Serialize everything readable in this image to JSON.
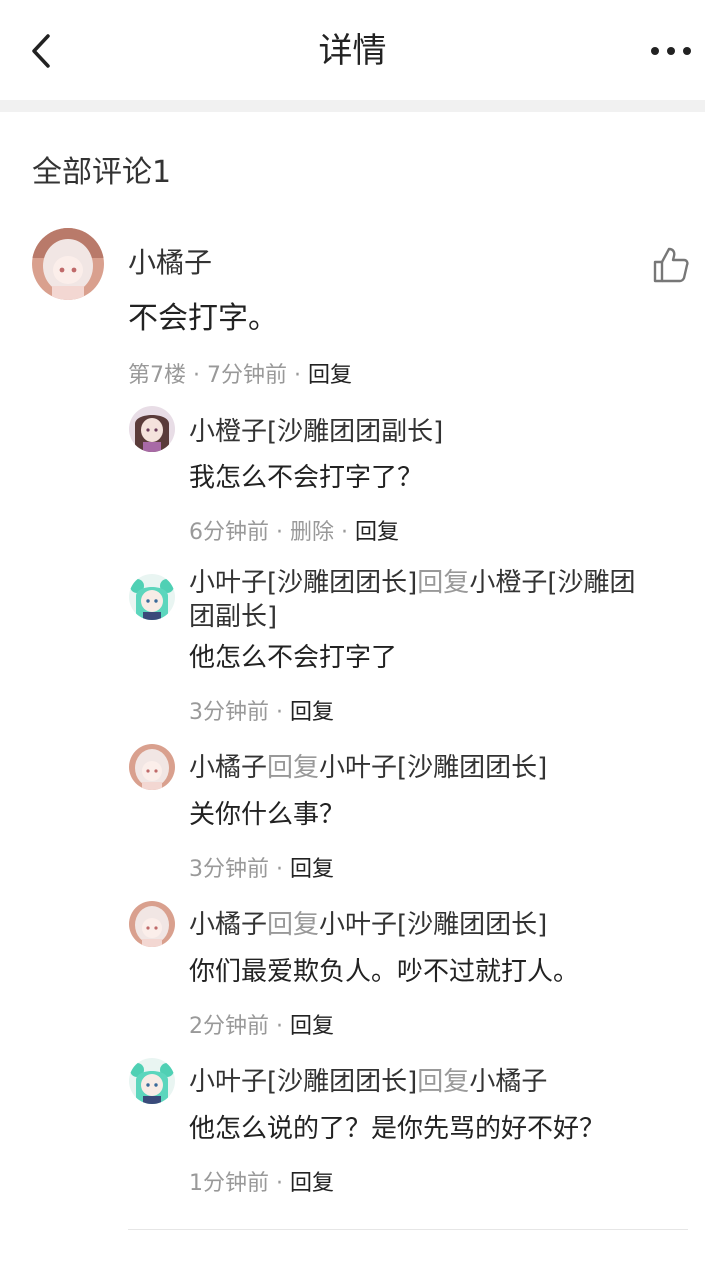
{
  "header": {
    "title": "详情"
  },
  "section": {
    "title": "全部评论1"
  },
  "main_comment": {
    "author": "小橘子",
    "text": "不会打字。",
    "floor": "第7楼",
    "time": "7分钟前",
    "reply_label": "回复"
  },
  "replies": [
    {
      "author": "小橙子[沙雕团团副长]",
      "text": "我怎么不会打字了？",
      "time": "6分钟前",
      "delete_label": "删除",
      "reply_label": "回复"
    },
    {
      "author": "小叶子[沙雕团团长]",
      "reply_word": "回复",
      "target": "小橙子[沙雕团团副长]",
      "text": "他怎么不会打字了",
      "time": "3分钟前",
      "reply_label": "回复"
    },
    {
      "author": "小橘子",
      "reply_word": "回复",
      "target": "小叶子[沙雕团团长]",
      "text": "关你什么事？",
      "time": "3分钟前",
      "reply_label": "回复"
    },
    {
      "author": "小橘子",
      "reply_word": "回复",
      "target": "小叶子[沙雕团团长]",
      "text": "你们最爱欺负人。吵不过就打人。",
      "time": "2分钟前",
      "reply_label": "回复"
    },
    {
      "author": "小叶子[沙雕团团长]",
      "reply_word": "回复",
      "target": "小橘子",
      "text": "他怎么说的了？是你先骂的好不好？",
      "time": "1分钟前",
      "reply_label": "回复"
    }
  ],
  "separator": " · ",
  "colors": {
    "secondary_text": "#999999",
    "primary_text": "#222222",
    "band": "#f1f1f1"
  }
}
